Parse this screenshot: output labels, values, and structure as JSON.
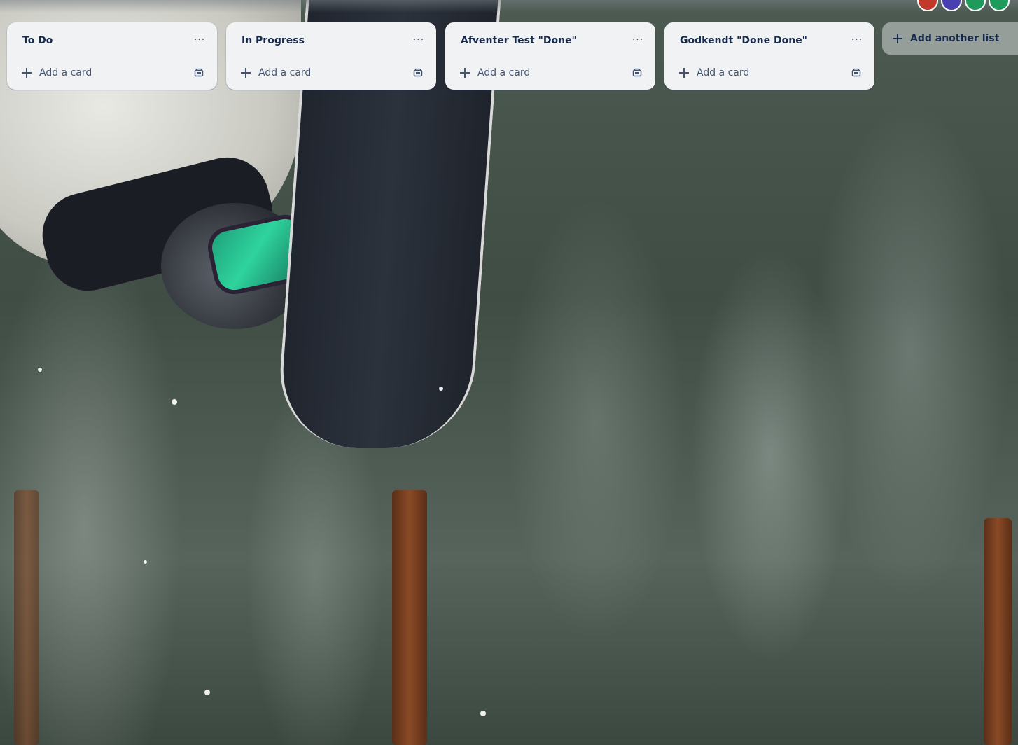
{
  "board": {
    "lists": [
      {
        "title": "To Do",
        "menu_label": "···",
        "add_card_label": "Add a card"
      },
      {
        "title": "In Progress",
        "menu_label": "···",
        "add_card_label": "Add a card"
      },
      {
        "title": "Afventer Test \"Done\"",
        "menu_label": "···",
        "add_card_label": "Add a card"
      },
      {
        "title": "Godkendt \"Done Done\"",
        "menu_label": "···",
        "add_card_label": "Add a card"
      }
    ],
    "add_list_label": "Add another list"
  },
  "icons": {
    "list_menu": "more-horizontal-icon",
    "add_card": "plus-icon",
    "card_template": "card-template-icon",
    "add_list": "plus-icon"
  },
  "colors": {
    "list_background": "#f1f2f4",
    "text_primary": "#172b4d",
    "text_secondary": "#44546f",
    "avatar_1": "#c0392b",
    "avatar_2": "#4a3fb0",
    "avatar_3": "#1e9a5a",
    "avatar_4": "#1e9a5a"
  }
}
